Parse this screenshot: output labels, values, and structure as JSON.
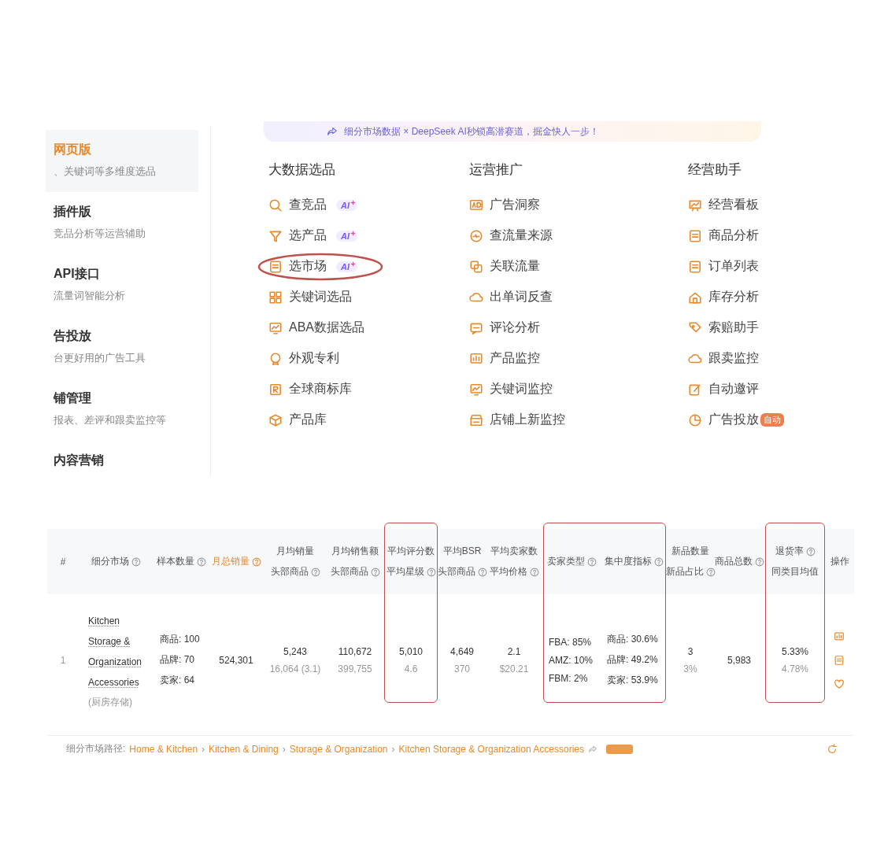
{
  "banner": {
    "text": "细分市场数据 × DeepSeek AI秒锁高潜赛道，掘金快人一步！"
  },
  "sidebar": {
    "items": [
      {
        "title": "网页版",
        "description": "、关键词等多维度选品",
        "selected": true
      },
      {
        "title": "插件版",
        "description": "竞品分析等运营辅助",
        "selected": false
      },
      {
        "title": "API接口",
        "description": "流量词智能分析",
        "selected": false
      },
      {
        "title": "告投放",
        "description": "台更好用的广告工具",
        "selected": false
      },
      {
        "title": "铺管理",
        "description": "报表、差评和跟卖监控等",
        "selected": false
      },
      {
        "title": "内容营销",
        "selected": false
      }
    ]
  },
  "menu": {
    "groups": [
      {
        "title": "大数据选品",
        "items": [
          {
            "label": "查竞品",
            "badge": {
              "kind": "ai",
              "text": "AI"
            },
            "circled": false
          },
          {
            "label": "选产品",
            "badge": {
              "kind": "ai",
              "text": "AI"
            },
            "circled": false
          },
          {
            "label": "选市场",
            "badge": {
              "kind": "ai",
              "text": "AI"
            },
            "circled": true
          },
          {
            "label": "关键词选品",
            "circled": false
          },
          {
            "label": "ABA数据选品",
            "circled": false
          },
          {
            "label": "外观专利",
            "circled": false
          },
          {
            "label": "全球商标库",
            "circled": false
          },
          {
            "label": "产品库",
            "circled": false
          }
        ]
      },
      {
        "title": "运营推广",
        "items": [
          {
            "label": "广告洞察",
            "circled": false
          },
          {
            "label": "查流量来源",
            "circled": false
          },
          {
            "label": "关联流量",
            "circled": false
          },
          {
            "label": "出单词反查",
            "circled": false
          },
          {
            "label": "评论分析",
            "circled": false
          },
          {
            "label": "产品监控",
            "circled": false
          },
          {
            "label": "关键词监控",
            "circled": false
          },
          {
            "label": "店铺上新监控",
            "circled": false
          }
        ]
      },
      {
        "title": "经营助手",
        "items": [
          {
            "label": "经营看板",
            "circled": false
          },
          {
            "label": "商品分析",
            "circled": false
          },
          {
            "label": "订单列表",
            "circled": false
          },
          {
            "label": "库存分析",
            "circled": false
          },
          {
            "label": "索赔助手",
            "circled": false
          },
          {
            "label": "跟卖监控",
            "circled": false
          },
          {
            "label": "自动邀评",
            "circled": false
          },
          {
            "label": "广告投放",
            "badge": {
              "kind": "auto",
              "text": "自动"
            },
            "circled": false
          }
        ]
      }
    ]
  },
  "table": {
    "columns": [
      {
        "lines": [
          {
            "text": "#",
            "help": false
          }
        ],
        "active": false,
        "highlighted": false
      },
      {
        "lines": [
          {
            "text": "细分市场",
            "help": true
          }
        ],
        "active": false,
        "highlighted": false
      },
      {
        "lines": [
          {
            "text": "样本数量",
            "help": true
          }
        ],
        "active": false,
        "highlighted": false
      },
      {
        "lines": [
          {
            "text": "月总销量",
            "help": true
          }
        ],
        "active": true,
        "highlighted": false
      },
      {
        "lines": [
          {
            "text": "月均销量",
            "help": false
          },
          {
            "text": "头部商品",
            "help": true
          }
        ],
        "active": false,
        "highlighted": false
      },
      {
        "lines": [
          {
            "text": "月均销售额",
            "help": false
          },
          {
            "text": "头部商品",
            "help": true
          }
        ],
        "active": false,
        "highlighted": false
      },
      {
        "lines": [
          {
            "text": "平均评分数",
            "help": false
          },
          {
            "text": "平均星级",
            "help": true
          }
        ],
        "active": false,
        "highlighted": true
      },
      {
        "lines": [
          {
            "text": "平均BSR",
            "help": false
          },
          {
            "text": "头部商品",
            "help": true
          }
        ],
        "active": false,
        "highlighted": false
      },
      {
        "lines": [
          {
            "text": "平均卖家数",
            "help": false
          },
          {
            "text": "平均价格",
            "help": true
          }
        ],
        "active": false,
        "highlighted": false
      },
      {
        "lines": [
          {
            "text": "卖家类型",
            "help": true
          }
        ],
        "active": false,
        "highlighted": true
      },
      {
        "lines": [
          {
            "text": "集中度指标",
            "help": true
          }
        ],
        "active": false,
        "highlighted": true
      },
      {
        "lines": [
          {
            "text": "新品数量",
            "help": false
          },
          {
            "text": "新品占比",
            "help": true
          }
        ],
        "active": false,
        "highlighted": false
      },
      {
        "lines": [
          {
            "text": "商品总数",
            "help": true
          }
        ],
        "active": false,
        "highlighted": false
      },
      {
        "lines": [
          {
            "text": "退货率",
            "help": true
          },
          {
            "text": "同类目均值",
            "help": false
          }
        ],
        "active": false,
        "highlighted": true
      },
      {
        "lines": [
          {
            "text": "操作",
            "help": false
          }
        ],
        "active": false,
        "highlighted": false
      }
    ],
    "rows": [
      {
        "cells": [
          {
            "kind": "index",
            "value": "1"
          },
          {
            "kind": "market",
            "name": "Kitchen Storage & Organization Accessories",
            "note": "(厨房存储)"
          },
          {
            "kind": "list",
            "lines": [
              "商品: 100",
              "品牌: 70",
              "卖家: 64"
            ]
          },
          {
            "kind": "stacked",
            "value": "524,301"
          },
          {
            "kind": "stacked",
            "value": "5,243",
            "sub": "16,064 (3.1)"
          },
          {
            "kind": "stacked",
            "value": "110,672",
            "sub": "399,755"
          },
          {
            "kind": "stacked",
            "value": "5,010",
            "sub": "4.6"
          },
          {
            "kind": "stacked",
            "value": "4,649",
            "sub": "370"
          },
          {
            "kind": "stacked",
            "value": "2.1",
            "sub": "$20.21"
          },
          {
            "kind": "list",
            "lines": [
              "FBA: 85%",
              "AMZ: 10%",
              "FBM: 2%"
            ]
          },
          {
            "kind": "list",
            "lines": [
              "商品: 30.6%",
              "品牌: 49.2%",
              "卖家: 53.9%"
            ]
          },
          {
            "kind": "stacked",
            "value": "3",
            "sub": "3%"
          },
          {
            "kind": "stacked",
            "value": "5,983"
          },
          {
            "kind": "stacked",
            "value": "5.33%",
            "sub": "4.78%"
          },
          {
            "kind": "actions"
          }
        ]
      }
    ]
  },
  "path": {
    "label": "细分市场路径:",
    "separator": "›",
    "items": [
      "Home & Kitchen",
      "Kitchen & Dining",
      "Storage & Organization",
      "Kitchen Storage & Organization Accessories"
    ]
  }
}
